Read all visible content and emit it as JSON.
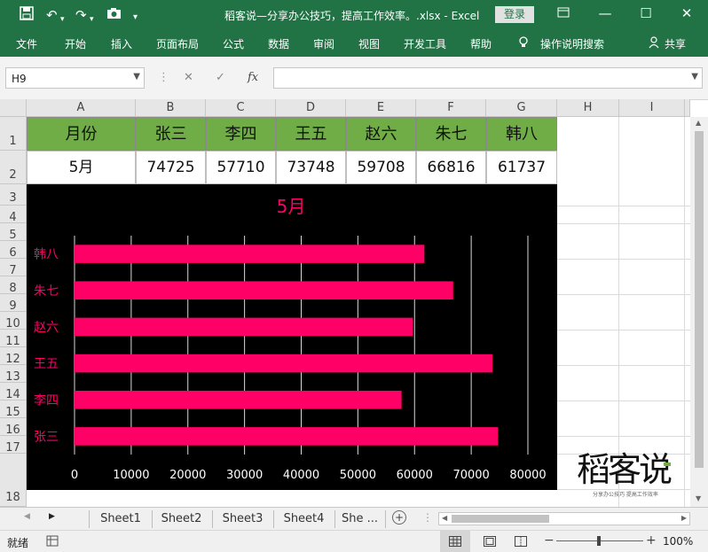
{
  "titlebar": {
    "title": "稻客说—分享办公技巧，提高工作效率。.xlsx - Excel",
    "login_label": "登录",
    "qa_icons": [
      "save-icon",
      "undo-icon",
      "redo-icon",
      "camera-icon",
      "customize-icon"
    ]
  },
  "ribbon": {
    "tabs": [
      "文件",
      "开始",
      "插入",
      "页面布局",
      "公式",
      "数据",
      "审阅",
      "视图",
      "开发工具",
      "帮助"
    ],
    "tell_me": "操作说明搜索",
    "share": "共享"
  },
  "formula_bar": {
    "name_box": "H9",
    "fx": "fx",
    "formula": ""
  },
  "columns": [
    "A",
    "B",
    "C",
    "D",
    "E",
    "F",
    "G",
    "H",
    "I"
  ],
  "rows": [
    "1",
    "2",
    "3",
    "4",
    "5",
    "6",
    "7",
    "8",
    "9",
    "10",
    "11",
    "12",
    "13",
    "14",
    "15",
    "16",
    "17",
    "18"
  ],
  "table": {
    "headers": [
      "月份",
      "张三",
      "李四",
      "王五",
      "赵六",
      "朱七",
      "韩八"
    ],
    "row": [
      "5月",
      "74725",
      "57710",
      "73748",
      "59708",
      "66816",
      "61737"
    ]
  },
  "chart_data": {
    "type": "bar",
    "orientation": "horizontal",
    "title": "5月",
    "categories": [
      "韩八",
      "朱七",
      "赵六",
      "王五",
      "李四",
      "张三"
    ],
    "values": [
      61737,
      66816,
      59708,
      73748,
      57710,
      74725
    ],
    "xlim": [
      0,
      80000
    ],
    "xticks": [
      "0",
      "10000",
      "20000",
      "30000",
      "40000",
      "50000",
      "60000",
      "70000",
      "80000"
    ],
    "grid": true,
    "bar_color": "#ff0066",
    "background": "#000000"
  },
  "watermark": {
    "text": "稻客说",
    "sub": "分享办公技巧 提高工作效率"
  },
  "sheets": [
    "Sheet1",
    "Sheet2",
    "Sheet3",
    "Sheet4",
    "She ..."
  ],
  "status": {
    "ready": "就绪",
    "zoom": "100%"
  },
  "colors": {
    "excel_green": "#217346",
    "header_fill": "#70ad47"
  }
}
